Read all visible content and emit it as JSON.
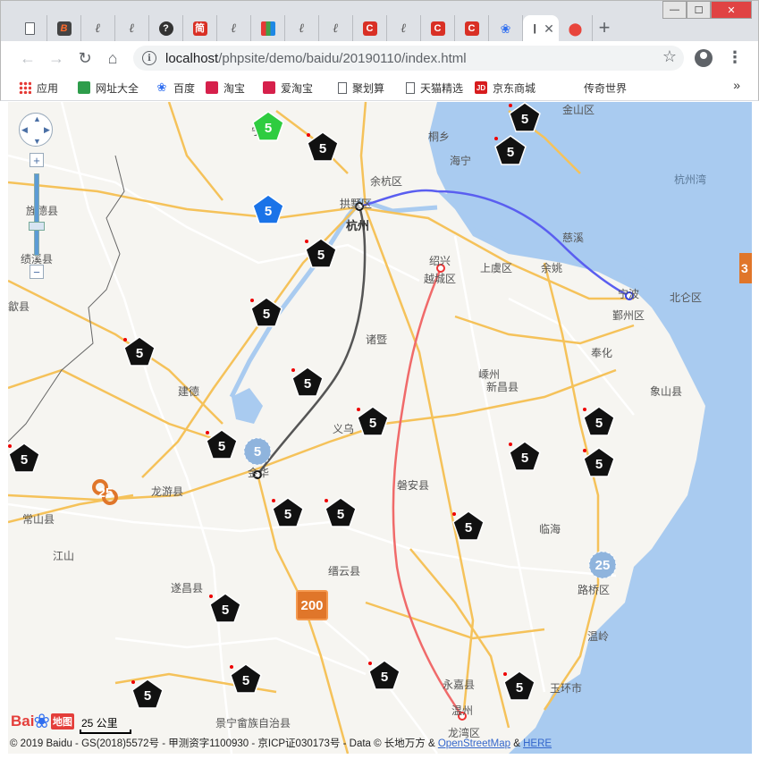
{
  "window": {
    "tabs": [
      {
        "icon": "document-icon",
        "label": ""
      },
      {
        "icon": "b-logo-icon",
        "label": "B"
      },
      {
        "icon": "scribble-icon",
        "label": "ℓ"
      },
      {
        "icon": "scribble-icon",
        "label": "ℓ"
      },
      {
        "icon": "question-icon",
        "label": "?"
      },
      {
        "icon": "jian-icon",
        "label": "简"
      },
      {
        "icon": "scribble-icon",
        "label": "ℓ"
      },
      {
        "icon": "colorful-grid-icon",
        "label": ""
      },
      {
        "icon": "scribble-icon",
        "label": "ℓ"
      },
      {
        "icon": "scribble-icon",
        "label": "ℓ"
      },
      {
        "icon": "c-red-icon",
        "label": "C"
      },
      {
        "icon": "scribble-icon",
        "label": "ℓ"
      },
      {
        "icon": "c-red-icon",
        "label": "C"
      },
      {
        "icon": "c-red-icon",
        "label": "C"
      },
      {
        "icon": "baidu-paw-icon",
        "label": "❀"
      },
      {
        "icon": "active-tab",
        "label": "|"
      },
      {
        "icon": "map-pin-icon",
        "label": "⬤"
      }
    ],
    "tab_close": "✕",
    "new_tab": "+",
    "minimize": "—",
    "maximize": "☐",
    "close": "✕"
  },
  "toolbar": {
    "url_host": "localhost",
    "url_path": "/phpsite/demo/baidu/20190110/index.html",
    "info": "i",
    "back": "←",
    "forward": "→",
    "reload": "↻",
    "home": "⌂",
    "star": "☆",
    "menu": "⋮"
  },
  "bookmarks": [
    {
      "label": "应用",
      "icon": "apps-icon"
    },
    {
      "label": "网址大全",
      "icon": "site-nav-icon"
    },
    {
      "label": "百度",
      "icon": "baidu-icon"
    },
    {
      "label": "淘宝",
      "icon": "taobao-icon"
    },
    {
      "label": "爱淘宝",
      "icon": "ai-taobao-icon"
    },
    {
      "label": "聚划算",
      "icon": "document-icon"
    },
    {
      "label": "天猫精选",
      "icon": "document-icon"
    },
    {
      "label": "京东商城",
      "icon": "jd-icon"
    },
    {
      "label": "传奇世界",
      "icon": ""
    }
  ],
  "bookmarks_more": "»",
  "map": {
    "places": [
      {
        "name": "宁国"
      },
      {
        "name": "桐乡"
      },
      {
        "name": "海宁"
      },
      {
        "name": "余杭区"
      },
      {
        "name": "拱墅区"
      },
      {
        "name": "杭州"
      },
      {
        "name": "杭州湾"
      },
      {
        "name": "慈溪"
      },
      {
        "name": "绍兴"
      },
      {
        "name": "越城区"
      },
      {
        "name": "上虞区"
      },
      {
        "name": "余姚"
      },
      {
        "name": "宁波"
      },
      {
        "name": "鄞州区"
      },
      {
        "name": "北仑区"
      },
      {
        "name": "旌德县"
      },
      {
        "name": "绩溪县"
      },
      {
        "name": "歙县"
      },
      {
        "name": "诸暨"
      },
      {
        "name": "奉化"
      },
      {
        "name": "建德"
      },
      {
        "name": "嵊州"
      },
      {
        "name": "新昌县"
      },
      {
        "name": "象山县"
      },
      {
        "name": "义乌"
      },
      {
        "name": "金华"
      },
      {
        "name": "龙游县"
      },
      {
        "name": "常山县"
      },
      {
        "name": "磐安县"
      },
      {
        "name": "临海"
      },
      {
        "name": "江山"
      },
      {
        "name": "缙云县"
      },
      {
        "name": "遂昌县"
      },
      {
        "name": "路桥区"
      },
      {
        "name": "温岭"
      },
      {
        "name": "玉环市"
      },
      {
        "name": "永嘉县"
      },
      {
        "name": "温州"
      },
      {
        "name": "龙湾区"
      },
      {
        "name": "景宁畲族自治县"
      },
      {
        "name": "金山区"
      }
    ],
    "markers": [
      "5",
      "5",
      "5",
      "5",
      "5",
      "5",
      "5",
      "5",
      "5",
      "5",
      "5",
      "5",
      "5",
      "5",
      "5",
      "5",
      "5",
      "5",
      "5",
      "5",
      "5",
      "5",
      "5",
      "5",
      "5"
    ],
    "highlight_markers": [
      "5",
      "5"
    ],
    "clusters": [
      "5",
      "25",
      "25",
      "200",
      "3"
    ],
    "colors": {
      "water": "#a9cbf0",
      "road_major": "#f5c25a",
      "road_minor": "#ffffff",
      "route_gray": "#555555",
      "route_red": "#f06a6a",
      "route_blue": "#5a5ef0",
      "marker_black": "#111111",
      "marker_green": "#2ecc40",
      "marker_blue": "#1a73e8",
      "cluster_blue": "#8fb4dd",
      "cluster_orange": "#e0762a"
    },
    "zoom_in": "+",
    "zoom_out": "−",
    "scale_label": "25 公里",
    "logo_text": "Bai",
    "logo_paw": "❀",
    "logo_map": "地图",
    "copyright_prefix": "© 2019 Baidu - GS(2018)5572号 - 甲测资字1100930 - 京ICP证030173号 - Data © 长地万方 & ",
    "copyright_osm": "OpenStreetMap",
    "copyright_amp": " & ",
    "copyright_here": "HERE"
  }
}
